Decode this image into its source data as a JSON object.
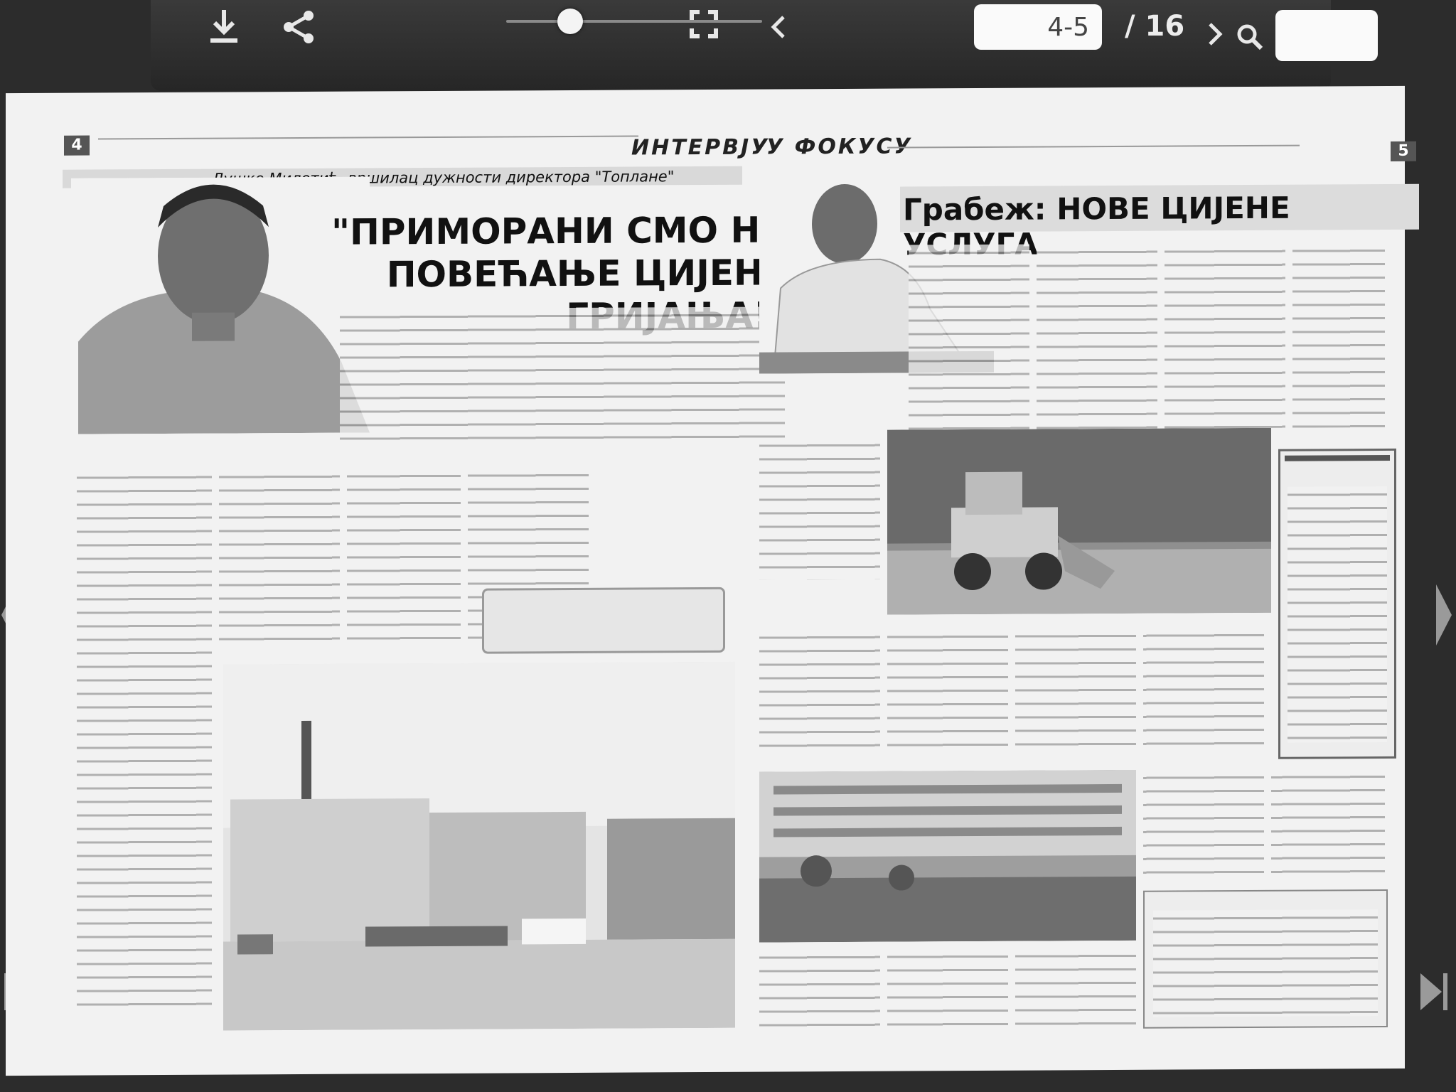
{
  "toolbar": {
    "download_icon": "download-icon",
    "share_icon": "share-icon",
    "zoom_level": 0.25,
    "fullscreen_icon": "fullscreen-icon",
    "prev_icon": "chevron-left-icon",
    "page_value": "4-5",
    "page_total": "/ 16",
    "next_icon": "chevron-right-icon",
    "search_value": "",
    "search_icon": "search-icon"
  },
  "nav": {
    "left_prev_icon": "triangle-left-icon",
    "left_first_icon": "first-page-icon",
    "right_next_icon": "triangle-right-icon",
    "right_last_icon": "last-page-icon"
  },
  "paper": {
    "left_page_number": "4",
    "right_page_number": "5",
    "left_section": "ИНТЕРВЈУ",
    "right_section": "У ФОКУСУ",
    "interview_subhead": "Душко Милетић, вршилац дужности директора \"Топлане\"",
    "interview_headline_line1": "\"ПРИМОРАНИ СМО НА",
    "interview_headline_line2": "ПОВЕЋАЊЕ ЦИЈЕНЕ ГРИЈАЊА!\"",
    "focus_headline": "Грабеж: НОВЕ ЦИЈЕНЕ УСЛУГА"
  }
}
